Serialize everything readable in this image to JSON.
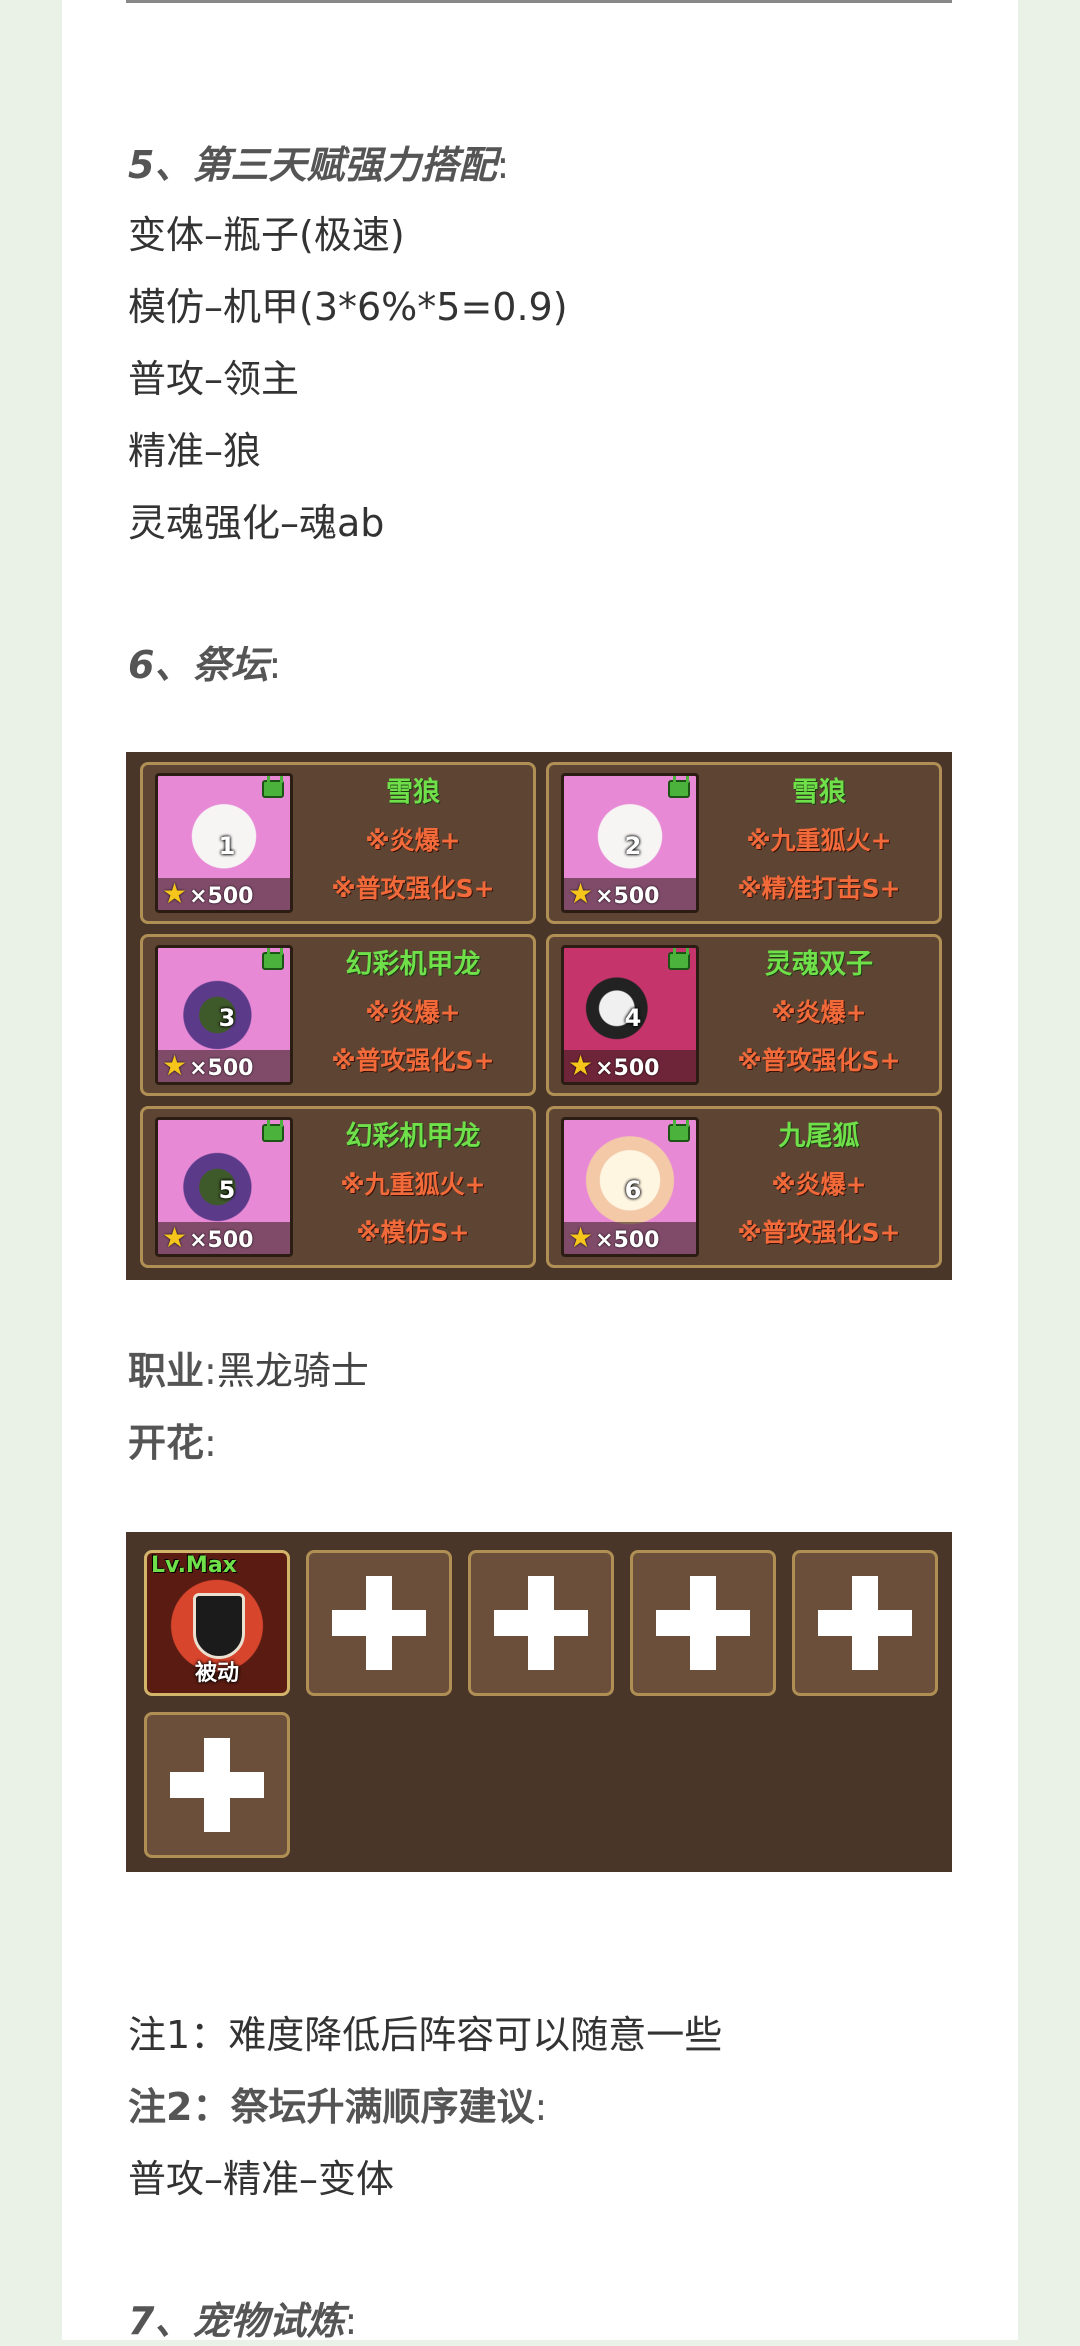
{
  "sections": {
    "s5": {
      "heading": "5、第三天赋强力搭配",
      "heading_colon": ":",
      "lines": [
        "变体–瓶子(极速)",
        "模仿–机甲(3*6%*5=0.9)",
        "普攻–领主",
        "精准–狼",
        "灵魂强化–魂ab"
      ]
    },
    "s6": {
      "heading": "6、祭坛",
      "heading_colon": ":"
    },
    "s7": {
      "heading": "7、宠物试炼",
      "heading_colon": ":"
    }
  },
  "altar": {
    "cards": [
      {
        "num": "1",
        "cost": "×500",
        "name": "雪狼",
        "skill1": "※炎爆+",
        "skill2": "※普攻强化S+",
        "icon": "snow-wolf-portrait"
      },
      {
        "num": "2",
        "cost": "×500",
        "name": "雪狼",
        "skill1": "※九重狐火+",
        "skill2": "※精准打击S+",
        "icon": "snow-wolf-portrait"
      },
      {
        "num": "3",
        "cost": "×500",
        "name": "幻彩机甲龙",
        "skill1": "※炎爆+",
        "skill2": "※普攻强化S+",
        "icon": "mecha-dragon-portrait"
      },
      {
        "num": "4",
        "cost": "×500",
        "name": "灵魂双子",
        "skill1": "※炎爆+",
        "skill2": "※普攻强化S+",
        "icon": "soul-twins-portrait"
      },
      {
        "num": "5",
        "cost": "×500",
        "name": "幻彩机甲龙",
        "skill1": "※九重狐火+",
        "skill2": "※模仿S+",
        "icon": "mecha-dragon-portrait"
      },
      {
        "num": "6",
        "cost": "×500",
        "name": "九尾狐",
        "skill1": "※炎爆+",
        "skill2": "※普攻强化S+",
        "icon": "nine-tailed-fox-portrait"
      }
    ]
  },
  "job": {
    "label": "职业",
    "colon": ":",
    "value": "黑龙骑士"
  },
  "bloom": {
    "label": "开花",
    "colon": ":",
    "skill": {
      "level": "Lv.Max",
      "type": "被动"
    }
  },
  "notes": {
    "note1_label": "注1",
    "note1_text": "：难度降低后阵容可以随意一些",
    "note2_label": "注2：祭坛升满顺序建议",
    "note2_colon": ":",
    "order": "普攻–精准–变体"
  },
  "colors": {
    "page_bg": "#eaf1e6",
    "panel_bg": "#4a3628",
    "pet_name": "#6fe04a",
    "skill_text": "#f36a3a",
    "star": "#f6c51b"
  }
}
